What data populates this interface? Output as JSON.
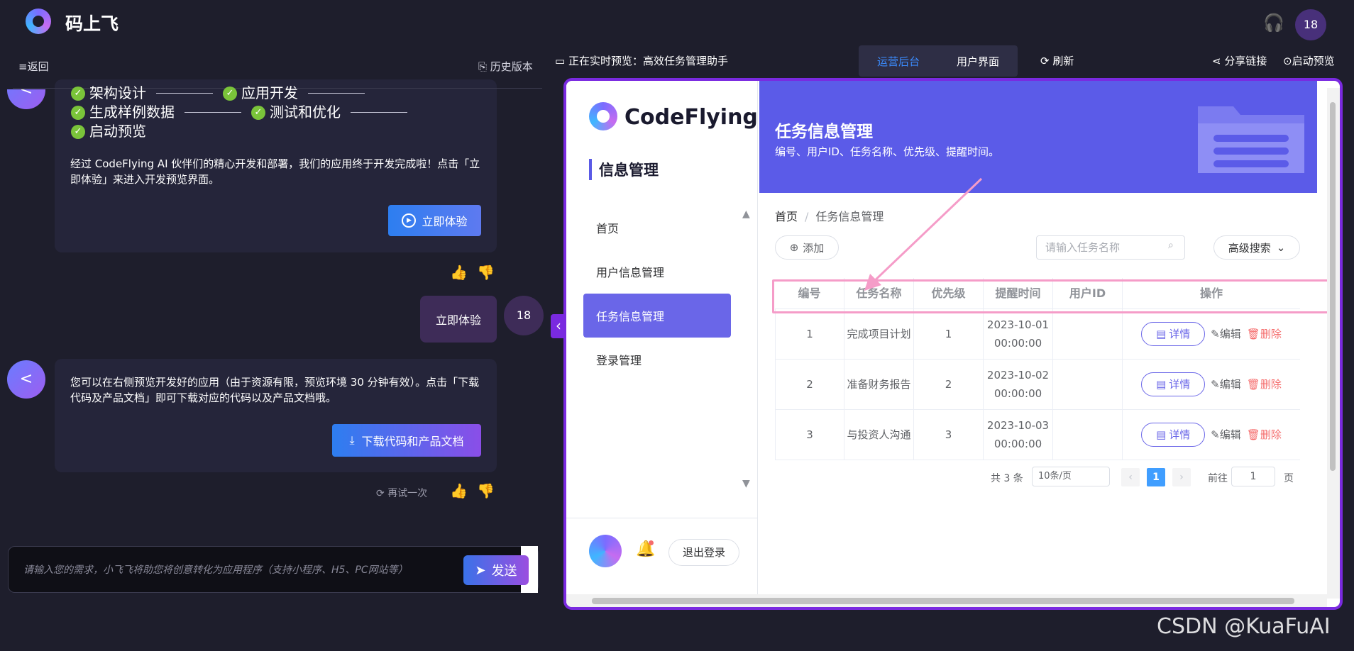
{
  "header": {
    "app_title": "码上飞",
    "user_initials": "18"
  },
  "left_panel": {
    "back_label": "≡返回",
    "history_label": "历史版本",
    "steps": [
      [
        "架构设计",
        "应用开发"
      ],
      [
        "生成样例数据",
        "测试和优化"
      ],
      [
        "启动预览"
      ]
    ],
    "card1_text": "经过 CodeFlying AI 伙伴们的精心开发和部署，我们的应用终于开发完成啦！点击「立即体验」来进入开发预览界面。",
    "try_button": "立即体验",
    "user_message": "立即体验",
    "user_avatar": "18",
    "card2_text": "您可以在右侧预览开发好的应用（由于资源有限，预览环境 30 分钟有效）。点击「下载代码及产品文档」即可下载对应的代码以及产品文档哦。",
    "download_button": "下载代码和产品文档",
    "retry_label": "再试一次",
    "input_placeholder": "请输入您的需求，小飞飞将助您将创意转化为应用程序（支持小程序、H5、PC网站等）",
    "send_button": "发送"
  },
  "preview_bar": {
    "status": "正在实时预览：高效任务管理助手",
    "tabs": [
      "运营后台",
      "用户界面"
    ],
    "refresh_label": "刷新",
    "share_label": "分享链接",
    "launch_label": "启动预览"
  },
  "app": {
    "brand": "CodeFlying",
    "section_title": "信息管理",
    "nav": [
      "首页",
      "用户信息管理",
      "任务信息管理",
      "登录管理"
    ],
    "logout_label": "退出登录",
    "banner_title": "任务信息管理",
    "banner_subtitle": "编号、用户ID、任务名称、优先级、提醒时间。",
    "breadcrumb_home": "首页",
    "breadcrumb_current": "任务信息管理",
    "add_label": "添加",
    "search_placeholder": "请输入任务名称",
    "advanced_search_label": "高级搜索",
    "table_headers": [
      "编号",
      "任务名称",
      "优先级",
      "提醒时间",
      "用户ID",
      "操作"
    ],
    "rows": [
      {
        "id": "1",
        "name": "完成项目计划",
        "priority": "1",
        "time": "2023-10-01 00:00:00",
        "user_id": ""
      },
      {
        "id": "2",
        "name": "准备财务报告",
        "priority": "2",
        "time": "2023-10-02 00:00:00",
        "user_id": ""
      },
      {
        "id": "3",
        "name": "与投资人沟通",
        "priority": "3",
        "time": "2023-10-03 00:00:00",
        "user_id": ""
      }
    ],
    "row_actions": {
      "detail": "详情",
      "edit": "编辑",
      "delete": "删除"
    },
    "pagination": {
      "total": "共 3 条",
      "page_size": "10条/页",
      "current": "1",
      "goto": "前往",
      "goto_value": "1",
      "page_unit": "页"
    }
  },
  "watermark": "CSDN @KuaFuAI",
  "colors": {
    "accent": "#6a66e8",
    "banner": "#5b5be8",
    "highlight": "#f59cc8",
    "frame": "#7a2ae0"
  }
}
